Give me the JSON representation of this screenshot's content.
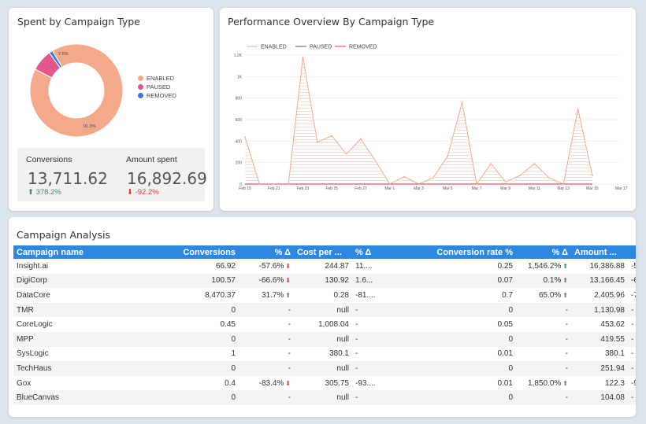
{
  "spent_card": {
    "title": "Spent by Campaign Type",
    "legend": [
      {
        "label": "ENABLED",
        "color": "#f4a98b"
      },
      {
        "label": "PAUSED",
        "color": "#e5568d"
      },
      {
        "label": "REMOVED",
        "color": "#2d7fd8"
      }
    ],
    "donut_labels": {
      "enabled": "91.3%",
      "paused": "7.5%"
    },
    "kpis": {
      "conversions_label": "Conversions",
      "conversions_value": "13,711.62",
      "conversions_delta": "378.2%",
      "amount_label": "Amount spent",
      "amount_value": "16,892.69",
      "amount_delta": "-92.2%"
    }
  },
  "perf_card": {
    "title": "Performance Overview By Campaign Type"
  },
  "chart_data": {
    "type": "area",
    "title": "Performance Overview By Campaign Type",
    "ylim": [
      0,
      1200
    ],
    "y_ticks": [
      "0",
      "200",
      "400",
      "600",
      "800",
      "1K",
      "1.2K"
    ],
    "x_ticks": [
      "Feb 19",
      "Feb 21",
      "Feb 23",
      "Feb 25",
      "Feb 27",
      "Mar 1",
      "Mar 3",
      "Mar 5",
      "Mar 7",
      "Mar 9",
      "Mar 11",
      "Mar 13",
      "Mar 15",
      "Mar 17"
    ],
    "legend_position": "top-left",
    "series": [
      {
        "name": "ENABLED",
        "color": "#f4a98b",
        "values": [
          440,
          0,
          0,
          0,
          1180,
          390,
          450,
          280,
          420,
          220,
          0,
          70,
          0,
          60,
          260,
          760,
          0,
          190,
          20,
          80,
          190,
          60,
          0,
          700,
          80
        ]
      },
      {
        "name": "PAUSED",
        "color": "#555555",
        "values": [
          0,
          0,
          0,
          0,
          0,
          0,
          0,
          0,
          0,
          0,
          0,
          0,
          0,
          0,
          0,
          0,
          0,
          0,
          0,
          0,
          0,
          0,
          0,
          0,
          0
        ]
      },
      {
        "name": "REMOVED",
        "color": "#d93b5a",
        "values": [
          0,
          0,
          0,
          0,
          0,
          0,
          0,
          0,
          0,
          0,
          0,
          0,
          0,
          0,
          0,
          0,
          0,
          0,
          0,
          0,
          0,
          0,
          0,
          0,
          0
        ]
      }
    ]
  },
  "analysis": {
    "title": "Campaign Analysis",
    "columns": [
      "Campaign name",
      "Conversions",
      "% Δ",
      "Cost per ...",
      "% Δ",
      "Conversion rate %",
      "% Δ",
      "Amount ...",
      "% Δ"
    ],
    "rows": [
      {
        "name": "Insight.ai",
        "conv": "66.92",
        "conv_d": "-57.6%",
        "conv_dir": "down",
        "cost": "244.87",
        "cost_d": "11....",
        "rate": "0.25",
        "rate_d": "1,546.2%",
        "rate_dir": "up",
        "amount": "16,386.88",
        "amount_d": "-53...."
      },
      {
        "name": "DigiCorp",
        "conv": "100.57",
        "conv_d": "-66.6%",
        "conv_dir": "down",
        "cost": "130.92",
        "cost_d": "1.6...",
        "rate": "0.07",
        "rate_d": "0.1%",
        "rate_dir": "up",
        "amount": "13,166.45",
        "amount_d": "-66...."
      },
      {
        "name": "DataCore",
        "conv": "8,470.37",
        "conv_d": "31.7%",
        "conv_dir": "up",
        "cost": "0.28",
        "cost_d": "-81....",
        "rate": "0.7",
        "rate_d": "65.0%",
        "rate_dir": "up",
        "amount": "2,405.96",
        "amount_d": "-76...."
      },
      {
        "name": "TMR",
        "conv": "0",
        "conv_d": "-",
        "conv_dir": "",
        "cost": "null",
        "cost_d": "-",
        "rate": "0",
        "rate_d": "-",
        "rate_dir": "",
        "amount": "1,130.98",
        "amount_d": "-"
      },
      {
        "name": "CoreLogic",
        "conv": "0.45",
        "conv_d": "-",
        "conv_dir": "",
        "cost": "1,008.04",
        "cost_d": "-",
        "rate": "0.05",
        "rate_d": "-",
        "rate_dir": "",
        "amount": "453.62",
        "amount_d": "-"
      },
      {
        "name": "MPP",
        "conv": "0",
        "conv_d": "-",
        "conv_dir": "",
        "cost": "null",
        "cost_d": "-",
        "rate": "0",
        "rate_d": "-",
        "rate_dir": "",
        "amount": "419.55",
        "amount_d": "-"
      },
      {
        "name": "SysLogic",
        "conv": "1",
        "conv_d": "-",
        "conv_dir": "",
        "cost": "380.1",
        "cost_d": "-",
        "rate": "0.01",
        "rate_d": "-",
        "rate_dir": "",
        "amount": "380.1",
        "amount_d": "-"
      },
      {
        "name": "TechHaus",
        "conv": "0",
        "conv_d": "-",
        "conv_dir": "",
        "cost": "null",
        "cost_d": "-",
        "rate": "0",
        "rate_d": "-",
        "rate_dir": "",
        "amount": "251.94",
        "amount_d": "-"
      },
      {
        "name": "Gox",
        "conv": "0.4",
        "conv_d": "-83.4%",
        "conv_dir": "down",
        "cost": "305.75",
        "cost_d": "-93....",
        "rate": "0.01",
        "rate_d": "1,850.0%",
        "rate_dir": "up",
        "amount": "122.3",
        "amount_d": "-98...."
      },
      {
        "name": "BlueCanvas",
        "conv": "0",
        "conv_d": "-",
        "conv_dir": "",
        "cost": "null",
        "cost_d": "-",
        "rate": "0",
        "rate_d": "-",
        "rate_dir": "",
        "amount": "104.08",
        "amount_d": "-"
      }
    ]
  }
}
